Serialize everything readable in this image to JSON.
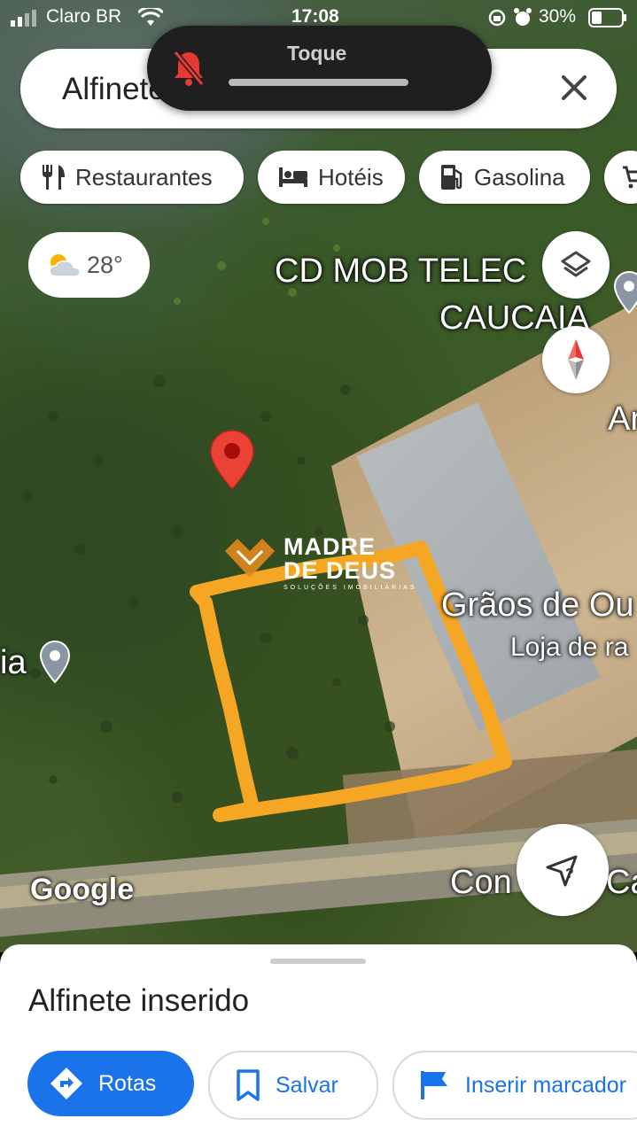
{
  "status_bar": {
    "carrier": "Claro BR",
    "time": "17:08",
    "battery": "30%"
  },
  "search": {
    "query": "Alfinete inserido"
  },
  "toast": {
    "title": "Toque",
    "volume_level": 0.0
  },
  "chips": [
    {
      "label": "Restaurantes",
      "icon": "fork-knife-icon"
    },
    {
      "label": "Hotéis",
      "icon": "bed-icon"
    },
    {
      "label": "Gasolina",
      "icon": "gas-pump-icon"
    }
  ],
  "weather": {
    "temperature": "28°",
    "icon": "partly-cloudy-icon"
  },
  "map": {
    "labels": {
      "cd_mob_line1": "CD MOB TELEC",
      "cd_mob_line2": "CAUCAIA",
      "an": "Ar",
      "graos": "Grãos de Ou",
      "loja": "Loja de ra",
      "ia": "ia",
      "con": "Con",
      "ca": "Ca"
    },
    "watermark": {
      "line1": "MADRE",
      "line2": "DE DEUS",
      "tagline": "SOLUÇÕES IMOBILIÁRIAS"
    },
    "attribution": "Google"
  },
  "colors": {
    "accent": "#1a73e8",
    "plot_outline": "#f5a623",
    "pin": "#ea4335"
  },
  "sheet": {
    "title": "Alfinete inserido",
    "actions": [
      {
        "label": "Rotas",
        "icon": "directions-icon"
      },
      {
        "label": "Salvar",
        "icon": "bookmark-icon"
      },
      {
        "label": "Inserir marcador",
        "icon": "flag-icon"
      }
    ]
  }
}
